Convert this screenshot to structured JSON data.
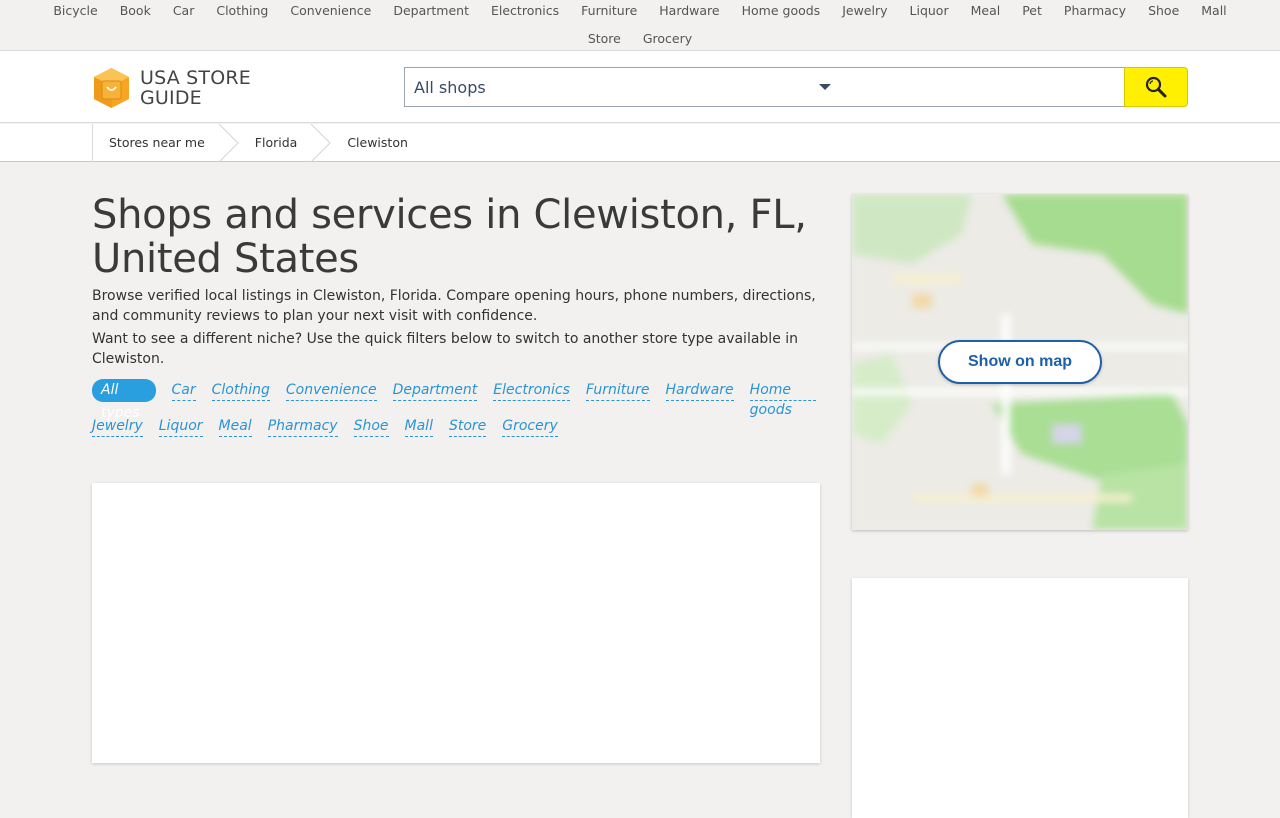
{
  "top_nav": {
    "row1": [
      "Bicycle",
      "Book",
      "Car",
      "Clothing",
      "Convenience",
      "Department",
      "Electronics",
      "Furniture",
      "Hardware",
      "Home goods",
      "Jewelry",
      "Liquor",
      "Meal",
      "Pet",
      "Pharmacy",
      "Shoe",
      "Mall"
    ],
    "row2": [
      "Store",
      "Grocery"
    ]
  },
  "header": {
    "logo_line1": "USA STORE",
    "logo_line2": "GUIDE",
    "select_value": "All shops",
    "search_placeholder": "",
    "search_icon": "search-icon",
    "logo_icon": "shopping-bag-icon"
  },
  "breadcrumb": [
    "Stores near me",
    "Florida",
    "Clewiston"
  ],
  "main": {
    "title": "Shops and services in Clewiston, FL, United States",
    "intro1": "Browse verified local listings in Clewiston, Florida. Compare opening hours, phone numbers, directions, and community reviews to plan your next visit with confidence.",
    "intro2": "Want to see a different niche? Use the quick filters below to switch to another store type available in Clewiston.",
    "filters_row1": [
      "All types",
      "Car",
      "Clothing",
      "Convenience",
      "Department",
      "Electronics",
      "Furniture",
      "Hardware",
      "Home goods"
    ],
    "filters_row2": [
      "Jewelry",
      "Liquor",
      "Meal",
      "Pharmacy",
      "Shoe",
      "Mall",
      "Store",
      "Grocery"
    ],
    "active_filter": "All types"
  },
  "map": {
    "button_label": "Show on map"
  },
  "colors": {
    "accent": "#2a9fe0",
    "search_button": "#ffef00",
    "map_button_border": "#1d5fa8",
    "background": "#f2f1ef"
  }
}
